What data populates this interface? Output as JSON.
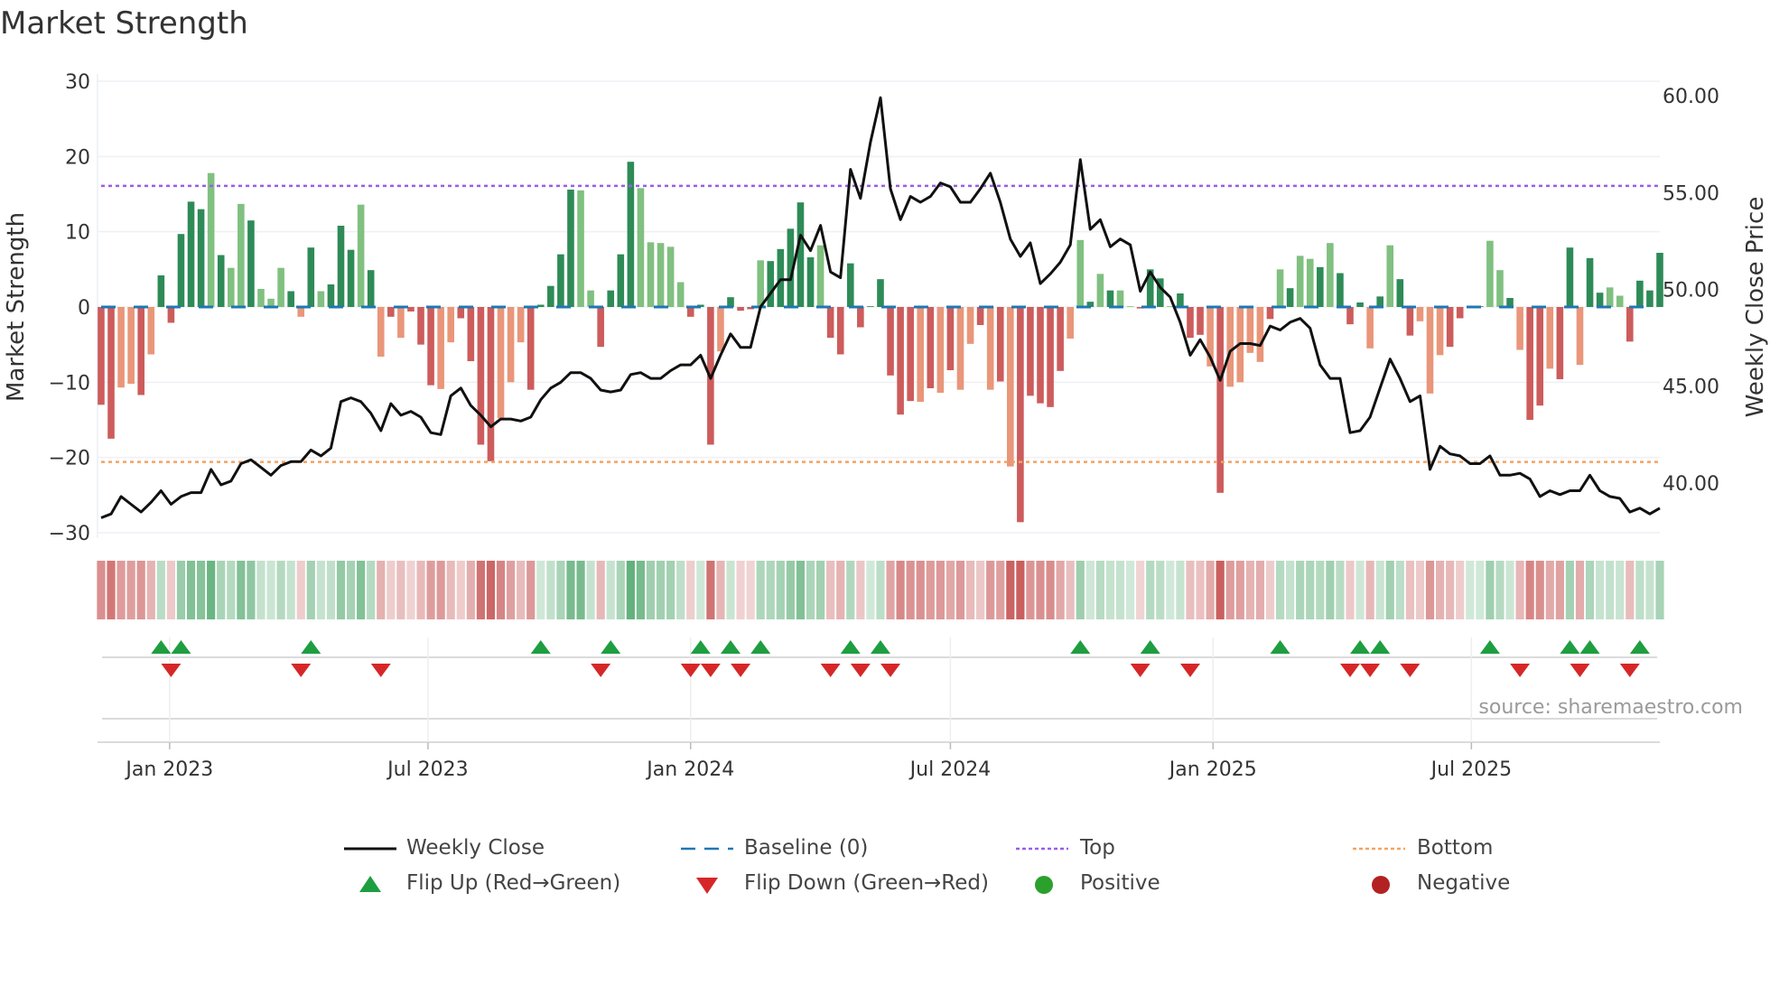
{
  "title": "Market Strength",
  "source": "source: sharemaestro.com",
  "legend": {
    "weekly_close": "Weekly Close",
    "baseline": "Baseline (0)",
    "top": "Top",
    "bottom": "Bottom",
    "flip_up": "Flip Up (Red→Green)",
    "flip_down": "Flip Down (Green→Red)",
    "positive": "Positive",
    "negative": "Negative"
  },
  "colors": {
    "pos_strong": "#2e8b57",
    "pos_weak": "#80c080",
    "neg_strong": "#cd5c5c",
    "neg_weak": "#e9967a",
    "line": "#111111",
    "baseline": "#1f77b4",
    "top": "#9b5de5",
    "bottom": "#f4a261",
    "flip_up": "#1e9e40",
    "flip_down": "#d62728",
    "positive_dot": "#2ca02c",
    "negative_dot": "#b22222"
  },
  "chart_data": {
    "type": "bar+line",
    "title": "Market Strength",
    "ylabel": "Market Strength",
    "y2label": "Weekly Close Price",
    "ylim": [
      -30,
      30
    ],
    "y2lim": [
      37.43,
      60.75
    ],
    "yticks": [
      "30",
      "20",
      "10",
      "0",
      "−10",
      "−20",
      "−30"
    ],
    "ytick_values": [
      30,
      20,
      10,
      0,
      -10,
      -20,
      -30
    ],
    "y2ticks": [
      "60.00",
      "55.00",
      "50.00",
      "45.00",
      "40.00"
    ],
    "y2tick_values": [
      60,
      55,
      50,
      45,
      40
    ],
    "x_start_week": "2022-11-14",
    "x_interval": "weekly",
    "xticks": [
      {
        "label": "Jan 2023",
        "date": "2023-01-01"
      },
      {
        "label": "Jul 2023",
        "date": "2023-07-01"
      },
      {
        "label": "Jan 2024",
        "date": "2024-01-01"
      },
      {
        "label": "Jul 2024",
        "date": "2024-07-01"
      },
      {
        "label": "Jan 2025",
        "date": "2025-01-01"
      },
      {
        "label": "Jul 2025",
        "date": "2025-07-01"
      }
    ],
    "top_level": 16.1,
    "bottom_level": -20.6,
    "baseline": 0,
    "strength": [
      -13.0,
      -17.5,
      -10.7,
      -10.2,
      -11.7,
      -6.3,
      4.2,
      -2.1,
      9.7,
      14.0,
      13.0,
      17.8,
      6.9,
      5.2,
      13.7,
      11.5,
      2.4,
      1.1,
      5.2,
      2.1,
      -1.3,
      7.9,
      2.1,
      3.0,
      10.8,
      7.6,
      13.6,
      4.9,
      -6.6,
      -1.3,
      -4.1,
      -0.6,
      -5.0,
      -10.4,
      -10.9,
      -4.7,
      -1.5,
      -7.2,
      -18.3,
      -20.5,
      -14.8,
      -10.0,
      -4.7,
      -11.0,
      0.3,
      2.8,
      7.0,
      15.6,
      15.5,
      2.2,
      -5.3,
      2.2,
      7.0,
      19.3,
      15.8,
      8.6,
      8.5,
      8.0,
      3.3,
      -1.3,
      0.3,
      -18.3,
      -5.9,
      1.3,
      -0.5,
      -0.3,
      6.2,
      6.1,
      7.7,
      10.4,
      13.9,
      6.6,
      8.2,
      -4.1,
      -6.3,
      5.8,
      -2.7,
      0.1,
      3.7,
      -9.1,
      -14.3,
      -12.5,
      -12.6,
      -10.8,
      -11.4,
      -8.4,
      -11.0,
      -4.9,
      -2.4,
      -11.0,
      -9.9,
      -21.2,
      -28.6,
      -11.8,
      -12.8,
      -13.3,
      -8.5,
      -4.2,
      8.9,
      0.7,
      4.4,
      2.2,
      2.2,
      0.1,
      -0.2,
      5.0,
      3.8,
      0.1,
      1.8,
      -4.1,
      -3.7,
      -7.9,
      -24.7,
      -10.6,
      -10.0,
      -6.1,
      -7.3,
      -1.6,
      5.0,
      2.5,
      6.8,
      6.4,
      5.3,
      8.5,
      4.5,
      -2.3,
      0.6,
      -5.5,
      1.4,
      8.2,
      3.7,
      -3.8,
      -1.9,
      -11.5,
      -6.4,
      -5.3,
      -1.5,
      0.1,
      0.1,
      8.8,
      4.9,
      1.2,
      -5.7,
      -15.0,
      -13.1,
      -8.2,
      -9.6,
      7.9,
      -7.7,
      6.5,
      1.9,
      2.6,
      1.5,
      -4.6,
      3.5,
      2.2,
      7.2
    ],
    "strength_shade": "ddlldldddddldlldllldldldddldldldddllddddllldddddllddddllllldddldddldddddldddddddddldldlldldldddddlldldlldddldddldlllldldlldldddldlddlllddddlldlddlddlddlldddddldldlldd",
    "weekly_close": [
      38.2,
      38.4,
      39.3,
      38.9,
      38.5,
      39.0,
      39.6,
      38.9,
      39.3,
      39.5,
      39.5,
      40.7,
      39.9,
      40.1,
      41.0,
      41.2,
      40.8,
      40.4,
      40.9,
      41.1,
      41.1,
      41.7,
      41.4,
      41.8,
      44.2,
      44.4,
      44.2,
      43.6,
      42.7,
      44.1,
      43.5,
      43.7,
      43.4,
      42.6,
      42.5,
      44.5,
      44.9,
      44.0,
      43.5,
      42.9,
      43.3,
      43.3,
      43.2,
      43.4,
      44.3,
      44.9,
      45.2,
      45.7,
      45.7,
      45.4,
      44.8,
      44.7,
      44.8,
      45.6,
      45.7,
      45.4,
      45.4,
      45.8,
      46.1,
      46.1,
      46.6,
      45.4,
      46.6,
      47.7,
      47.0,
      47.0,
      49.1,
      49.8,
      50.5,
      50.5,
      52.8,
      52.0,
      53.3,
      50.9,
      50.6,
      56.2,
      54.7,
      57.6,
      59.9,
      55.2,
      53.6,
      54.8,
      54.5,
      54.8,
      55.5,
      55.3,
      54.5,
      54.5,
      55.2,
      56.0,
      54.5,
      52.6,
      51.7,
      52.4,
      50.3,
      50.8,
      51.4,
      52.3,
      56.7,
      53.1,
      53.6,
      52.2,
      52.6,
      52.3,
      49.9,
      50.9,
      50.1,
      49.6,
      48.3,
      46.6,
      47.4,
      46.5,
      45.3,
      46.8,
      47.2,
      47.2,
      47.1,
      48.1,
      47.9,
      48.3,
      48.5,
      48.0,
      46.1,
      45.4,
      45.4,
      42.6,
      42.7,
      43.4,
      44.9,
      46.4,
      45.4,
      44.2,
      44.5,
      40.7,
      41.9,
      41.5,
      41.4,
      41.0,
      41.0,
      41.4,
      40.4,
      40.4,
      40.5,
      40.2,
      39.3,
      39.6,
      39.4,
      39.6,
      39.6,
      40.4,
      39.6,
      39.3,
      39.2,
      38.5,
      38.7,
      38.4,
      38.7
    ],
    "flip_up_weeks": [
      7,
      9,
      22,
      45,
      52,
      61,
      64,
      67,
      76,
      79,
      99,
      106,
      119,
      127,
      129,
      140,
      148,
      150,
      155
    ],
    "flip_down_weeks": [
      8,
      21,
      29,
      51,
      60,
      62,
      65,
      74,
      77,
      80,
      105,
      110,
      126,
      128,
      132,
      143,
      149,
      154
    ],
    "legend_position": "bottom"
  }
}
